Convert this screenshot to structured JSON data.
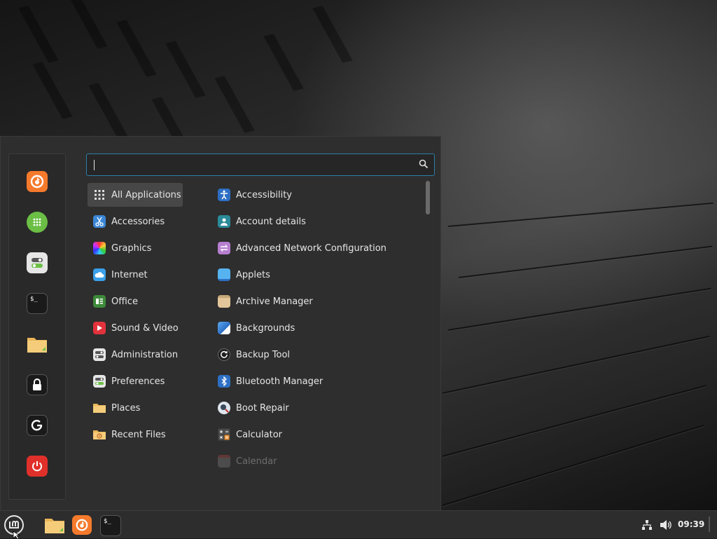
{
  "search": {
    "value": "",
    "placeholder": ""
  },
  "favorites": [
    {
      "name": "firefox-icon",
      "color": "#f57a2c"
    },
    {
      "name": "software-manager-icon",
      "color": "#6bbf45"
    },
    {
      "name": "settings-toggle-icon",
      "color": "#e0e0e0"
    },
    {
      "name": "terminal-icon",
      "color": "#1a1a1a"
    },
    {
      "name": "files-folder-icon",
      "color": "#f0c36a"
    },
    {
      "name": "lock-icon",
      "color": "#1a1a1a"
    },
    {
      "name": "logout-icon",
      "color": "#1a1a1a"
    },
    {
      "name": "power-icon",
      "color": "#e0302a"
    }
  ],
  "categories": [
    {
      "label": "All Applications",
      "icon": "grid-icon"
    },
    {
      "label": "Accessories",
      "icon": "scissors-icon"
    },
    {
      "label": "Graphics",
      "icon": "color-wheel-icon"
    },
    {
      "label": "Internet",
      "icon": "cloud-icon"
    },
    {
      "label": "Office",
      "icon": "office-icon"
    },
    {
      "label": "Sound & Video",
      "icon": "play-icon"
    },
    {
      "label": "Administration",
      "icon": "toggles-icon"
    },
    {
      "label": "Preferences",
      "icon": "toggles-green-icon"
    },
    {
      "label": "Places",
      "icon": "folder-icon"
    },
    {
      "label": "Recent Files",
      "icon": "recent-folder-icon"
    }
  ],
  "applications": [
    {
      "label": "Accessibility",
      "icon": "accessibility-icon"
    },
    {
      "label": "Account details",
      "icon": "account-icon"
    },
    {
      "label": "Advanced Network Configuration",
      "icon": "network-arrows-icon"
    },
    {
      "label": "Applets",
      "icon": "applets-icon"
    },
    {
      "label": "Archive Manager",
      "icon": "archive-icon"
    },
    {
      "label": "Backgrounds",
      "icon": "backgrounds-icon"
    },
    {
      "label": "Backup Tool",
      "icon": "backup-icon"
    },
    {
      "label": "Bluetooth Manager",
      "icon": "bluetooth-icon"
    },
    {
      "label": "Boot Repair",
      "icon": "boot-repair-icon"
    },
    {
      "label": "Calculator",
      "icon": "calculator-icon"
    },
    {
      "label": "Calendar",
      "icon": "calendar-icon"
    }
  ],
  "taskbar": {
    "items": [
      "mint-menu-icon",
      "files-folder-icon",
      "firefox-icon",
      "terminal-icon"
    ],
    "tray": [
      "network-icon",
      "volume-icon"
    ],
    "clock": "09:39"
  },
  "colors": {
    "accent": "#2b7fa8",
    "panel": "#2e2e2e",
    "selected": "#474747"
  }
}
